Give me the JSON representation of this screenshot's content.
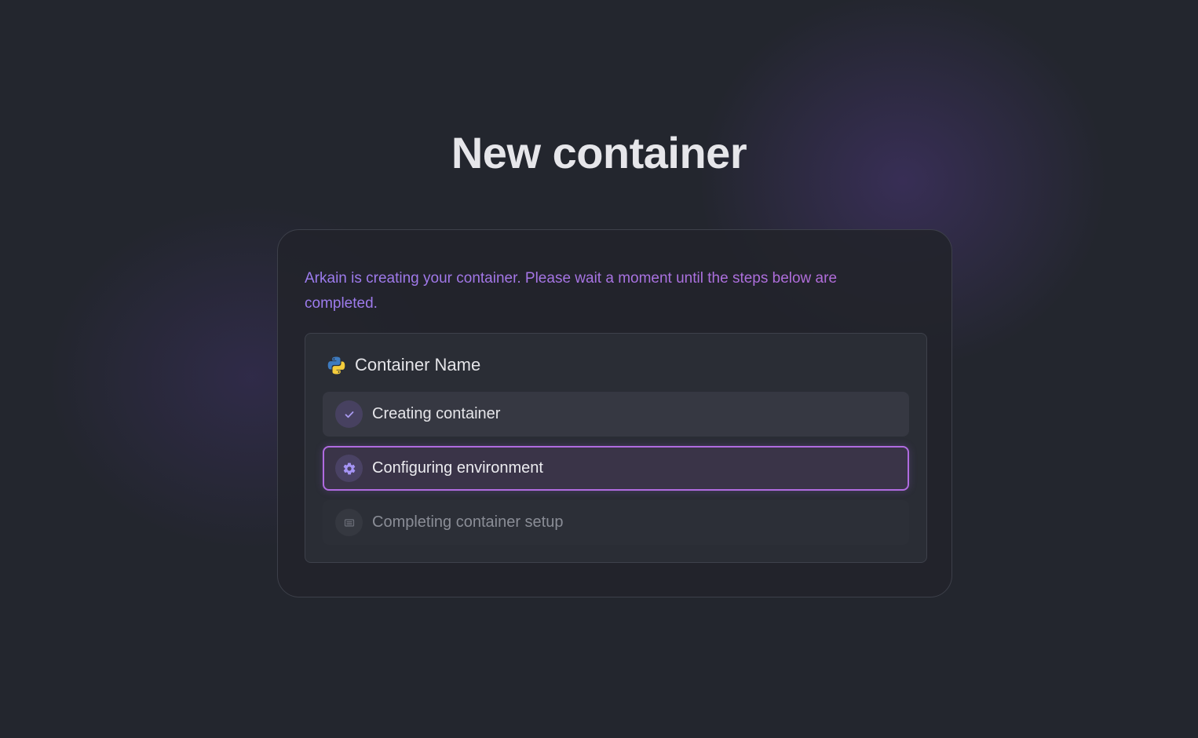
{
  "page": {
    "title": "New container"
  },
  "card": {
    "intro_text": "Arkain is creating your container. Please wait a moment until the steps below are completed.",
    "container": {
      "icon": "python-icon",
      "name": "Container Name"
    },
    "steps": [
      {
        "label": "Creating container",
        "status": "completed",
        "icon": "check-icon"
      },
      {
        "label": "Configuring environment",
        "status": "in-progress",
        "icon": "gear-icon"
      },
      {
        "label": "Completing container setup",
        "status": "pending",
        "icon": "server-icon"
      }
    ]
  },
  "colors": {
    "background": "#23262e",
    "accent": "#a877e8",
    "active_border": "#b06be0",
    "title": "#e6e6ea"
  }
}
